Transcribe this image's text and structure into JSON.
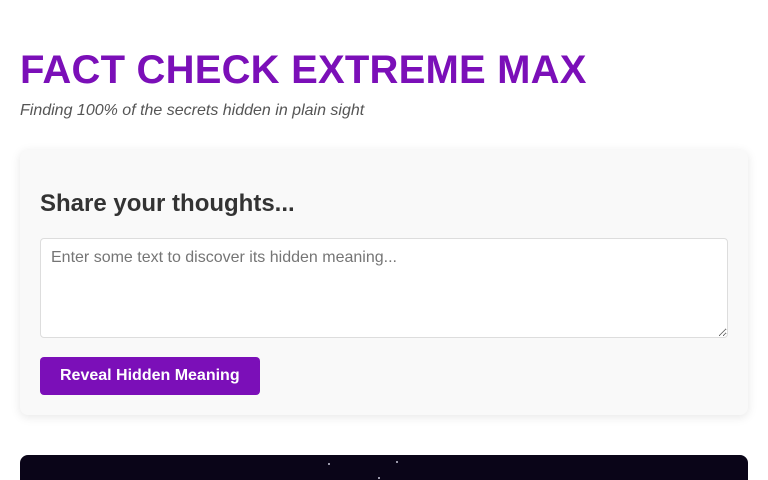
{
  "header": {
    "title": "FACT CHECK EXTREME MAX",
    "tagline": "Finding 100% of the secrets hidden in plain sight"
  },
  "input_card": {
    "heading": "Share your thoughts...",
    "textarea": {
      "value": "",
      "placeholder": "Enter some text to discover its hidden meaning..."
    },
    "submit_label": "Reveal Hidden Meaning"
  },
  "colors": {
    "accent": "#7b0fb8",
    "card_background": "#f9f9f9",
    "night_panel": "#0a0518"
  }
}
